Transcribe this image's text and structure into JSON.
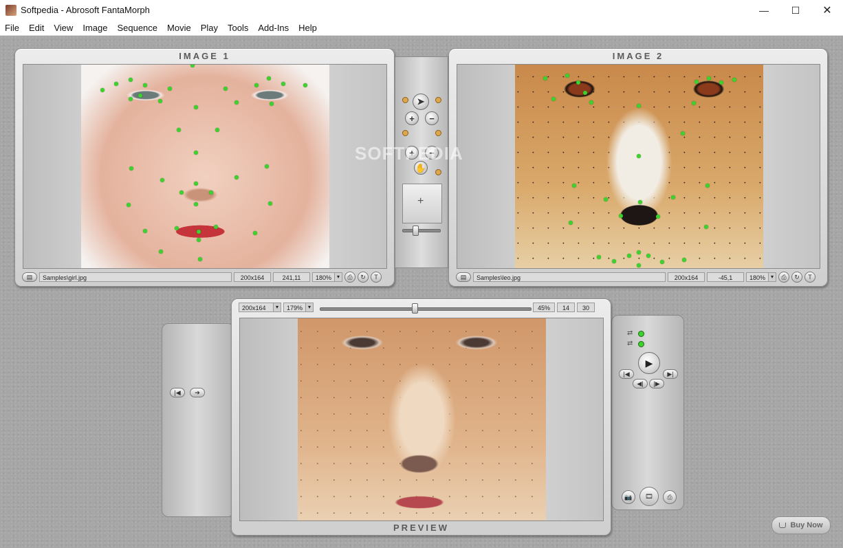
{
  "window": {
    "title": "Softpedia - Abrosoft FantaMorph",
    "minimize": "—",
    "maximize": "☐",
    "close": "✕"
  },
  "menu": [
    "File",
    "Edit",
    "View",
    "Image",
    "Sequence",
    "Movie",
    "Play",
    "Tools",
    "Add-Ins",
    "Help"
  ],
  "image1": {
    "title": "IMAGE 1",
    "path": "Samples\\girl.jpg",
    "size": "200x164",
    "coords": "241,11",
    "zoom": "180%"
  },
  "image2": {
    "title": "IMAGE 2",
    "path": "Samples\\leo.jpg",
    "size": "200x164",
    "coords": "-45,1",
    "zoom": "180%"
  },
  "preview": {
    "title": "PREVIEW",
    "size": "200x164",
    "zoom": "179%",
    "morph_percent": "45%",
    "frame": "14",
    "total_frames": "30",
    "slider_fraction": 0.45
  },
  "watermark": "SOFTPEDIA",
  "buy_now": "Buy Now",
  "icons": {
    "combo_arrow": "▾",
    "open": "▤",
    "plus": "+",
    "minus": "−",
    "cursor": "➤",
    "hand": "✋",
    "crosshair": "+",
    "play": "▶",
    "first": "|◀",
    "last": "▶|",
    "prev": "◀|",
    "next": "|▶",
    "arrow_right": "➔",
    "camera": "📷",
    "film": "🎞",
    "export": "⎙",
    "reset": "↻",
    "text": "T",
    "link": "⇄"
  },
  "colors": {
    "feature_point": "#3fd12f",
    "panel_bg": "#d9d9d9",
    "workspace_bg": "#a6a6a6"
  }
}
